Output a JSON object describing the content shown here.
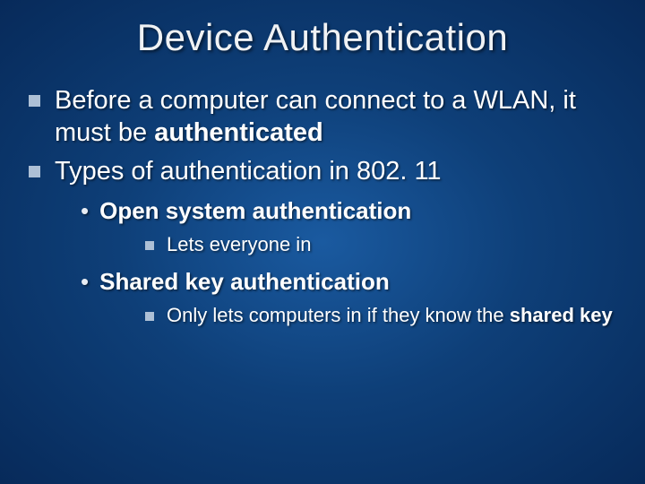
{
  "title": "Device Authentication",
  "bullets": {
    "b1_pre": "Before a computer can connect to a WLAN, it must be ",
    "b1_bold": "authenticated",
    "b2": "Types of authentication in 802. 11",
    "s1_bold": "Open system authentication",
    "s1_sub": "Lets everyone in",
    "s2_bold": "Shared key authentication",
    "s2_sub_pre": "Only lets computers in if they know the ",
    "s2_sub_bold": "shared key"
  }
}
